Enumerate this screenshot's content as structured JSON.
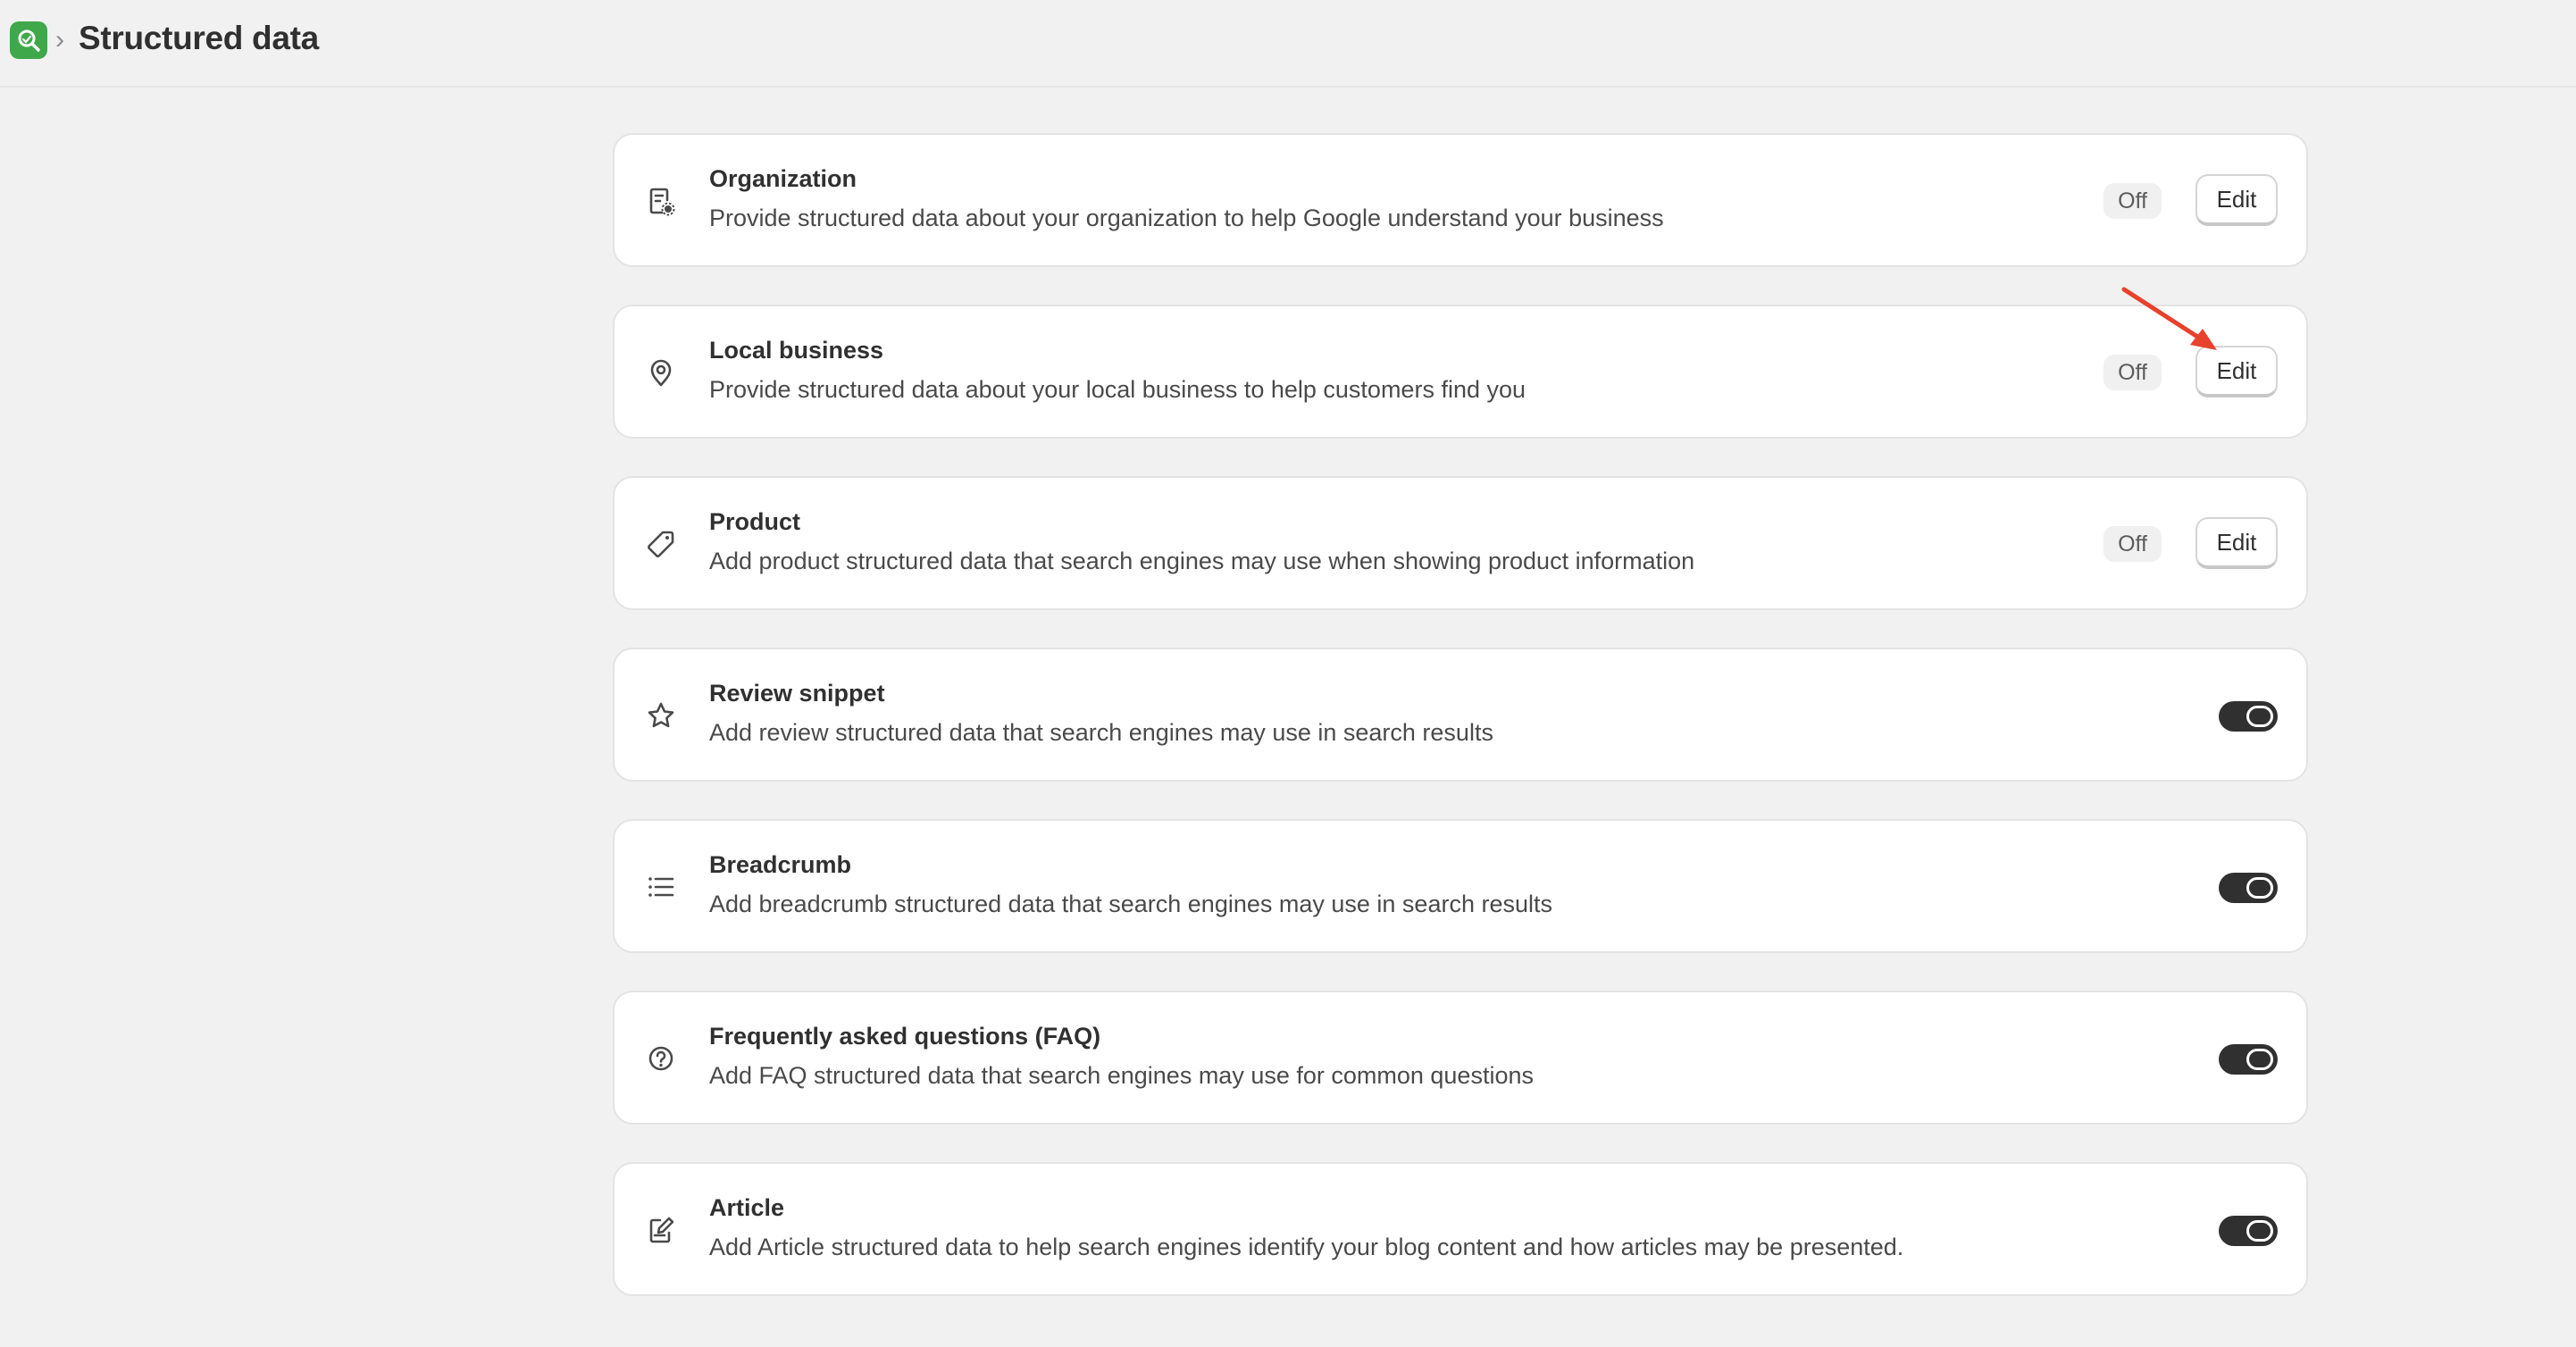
{
  "header": {
    "title": "Structured data",
    "separator": "›",
    "app_icon": "seo-app-icon"
  },
  "cards": [
    {
      "icon": "organization-icon",
      "title": "Organization",
      "description": "Provide structured data about your organization to help Google understand your business",
      "status": "Off",
      "action": "Edit"
    },
    {
      "icon": "location-pin-icon",
      "title": "Local business",
      "description": "Provide structured data about your local business to help customers find you",
      "status": "Off",
      "action": "Edit"
    },
    {
      "icon": "tag-icon",
      "title": "Product",
      "description": "Add product structured data that search engines may use when showing product information",
      "status": "Off",
      "action": "Edit"
    },
    {
      "icon": "star-icon",
      "title": "Review snippet",
      "description": "Add review structured data that search engines may use in search results",
      "enabled": true
    },
    {
      "icon": "list-icon",
      "title": "Breadcrumb",
      "description": "Add breadcrumb structured data that search engines may use in search results",
      "enabled": true
    },
    {
      "icon": "question-circle-icon",
      "title": "Frequently asked questions (FAQ)",
      "description": "Add FAQ structured data that search engines may use for common questions",
      "enabled": true
    },
    {
      "icon": "edit-document-icon",
      "title": "Article",
      "description": "Add Article structured data to help search engines identify your blog content and how articles may be presented.",
      "enabled": true
    }
  ],
  "colors": {
    "background": "#f1f1f1",
    "card": "#ffffff",
    "toggle_on": "#303030",
    "app_icon": "#3fa84a",
    "annotation_arrow": "#e8412c"
  }
}
